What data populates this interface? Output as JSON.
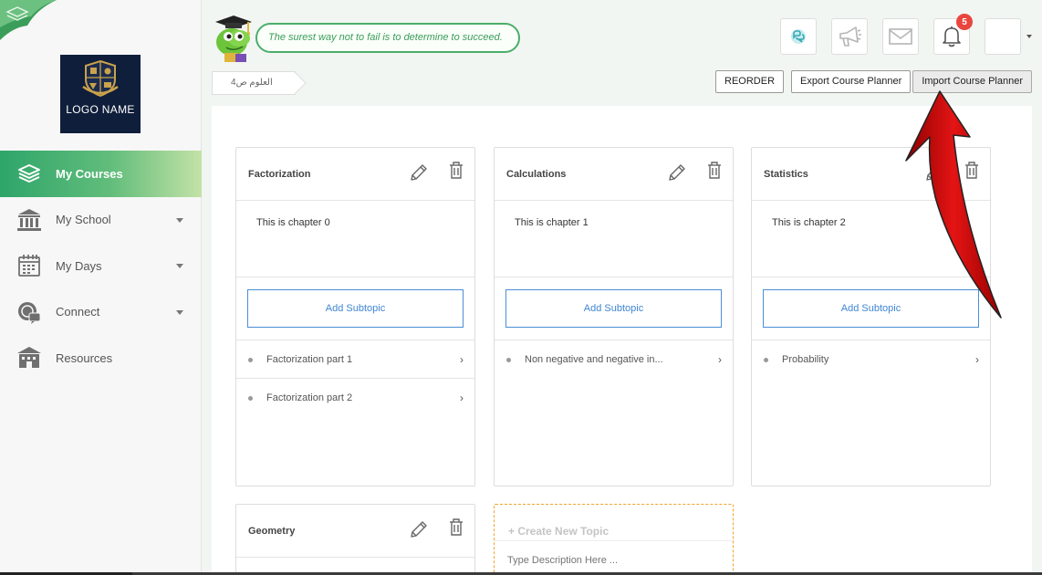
{
  "sidebar": {
    "logo_text": "LOGO NAME",
    "items": [
      {
        "label": "My Courses",
        "icon": "stack-layers-icon",
        "active": true,
        "caret": false
      },
      {
        "label": "My School",
        "icon": "school-building-icon",
        "active": false,
        "caret": true
      },
      {
        "label": "My Days",
        "icon": "calendar-icon",
        "active": false,
        "caret": true
      },
      {
        "label": "Connect",
        "icon": "connect-icon",
        "active": false,
        "caret": true
      },
      {
        "label": "Resources",
        "icon": "library-icon",
        "active": false,
        "caret": false
      }
    ]
  },
  "header": {
    "quote": "The surest way not to fail is to determine to succeed.",
    "notification_count": "5",
    "icons": [
      "chat-icon",
      "megaphone-icon",
      "mail-icon",
      "bell-icon"
    ]
  },
  "breadcrumb": "العلوم ص4",
  "actions": {
    "reorder": "REORDER",
    "export": "Export Course Planner",
    "import": "Import Course Planner"
  },
  "topics": [
    {
      "title": "Factorization",
      "description": "This is chapter 0",
      "add_subtopic": "Add Subtopic",
      "subtopics": [
        "Factorization part 1",
        "Factorization part 2"
      ]
    },
    {
      "title": "Calculations",
      "description": "This is chapter 1",
      "add_subtopic": "Add Subtopic",
      "subtopics": [
        "Non negative and negative in..."
      ]
    },
    {
      "title": "Statistics",
      "description": "This is chapter 2",
      "add_subtopic": "Add Subtopic",
      "subtopics": [
        "Probability"
      ]
    },
    {
      "title": "Geometry"
    }
  ],
  "new_topic": {
    "title": "+ Create New Topic",
    "placeholder": "Type Description Here ..."
  },
  "colors": {
    "accent_green": "#2ea56a",
    "link_blue": "#3f86d4",
    "badge_red": "#e8463f",
    "annotation_red": "#c40f0f"
  }
}
